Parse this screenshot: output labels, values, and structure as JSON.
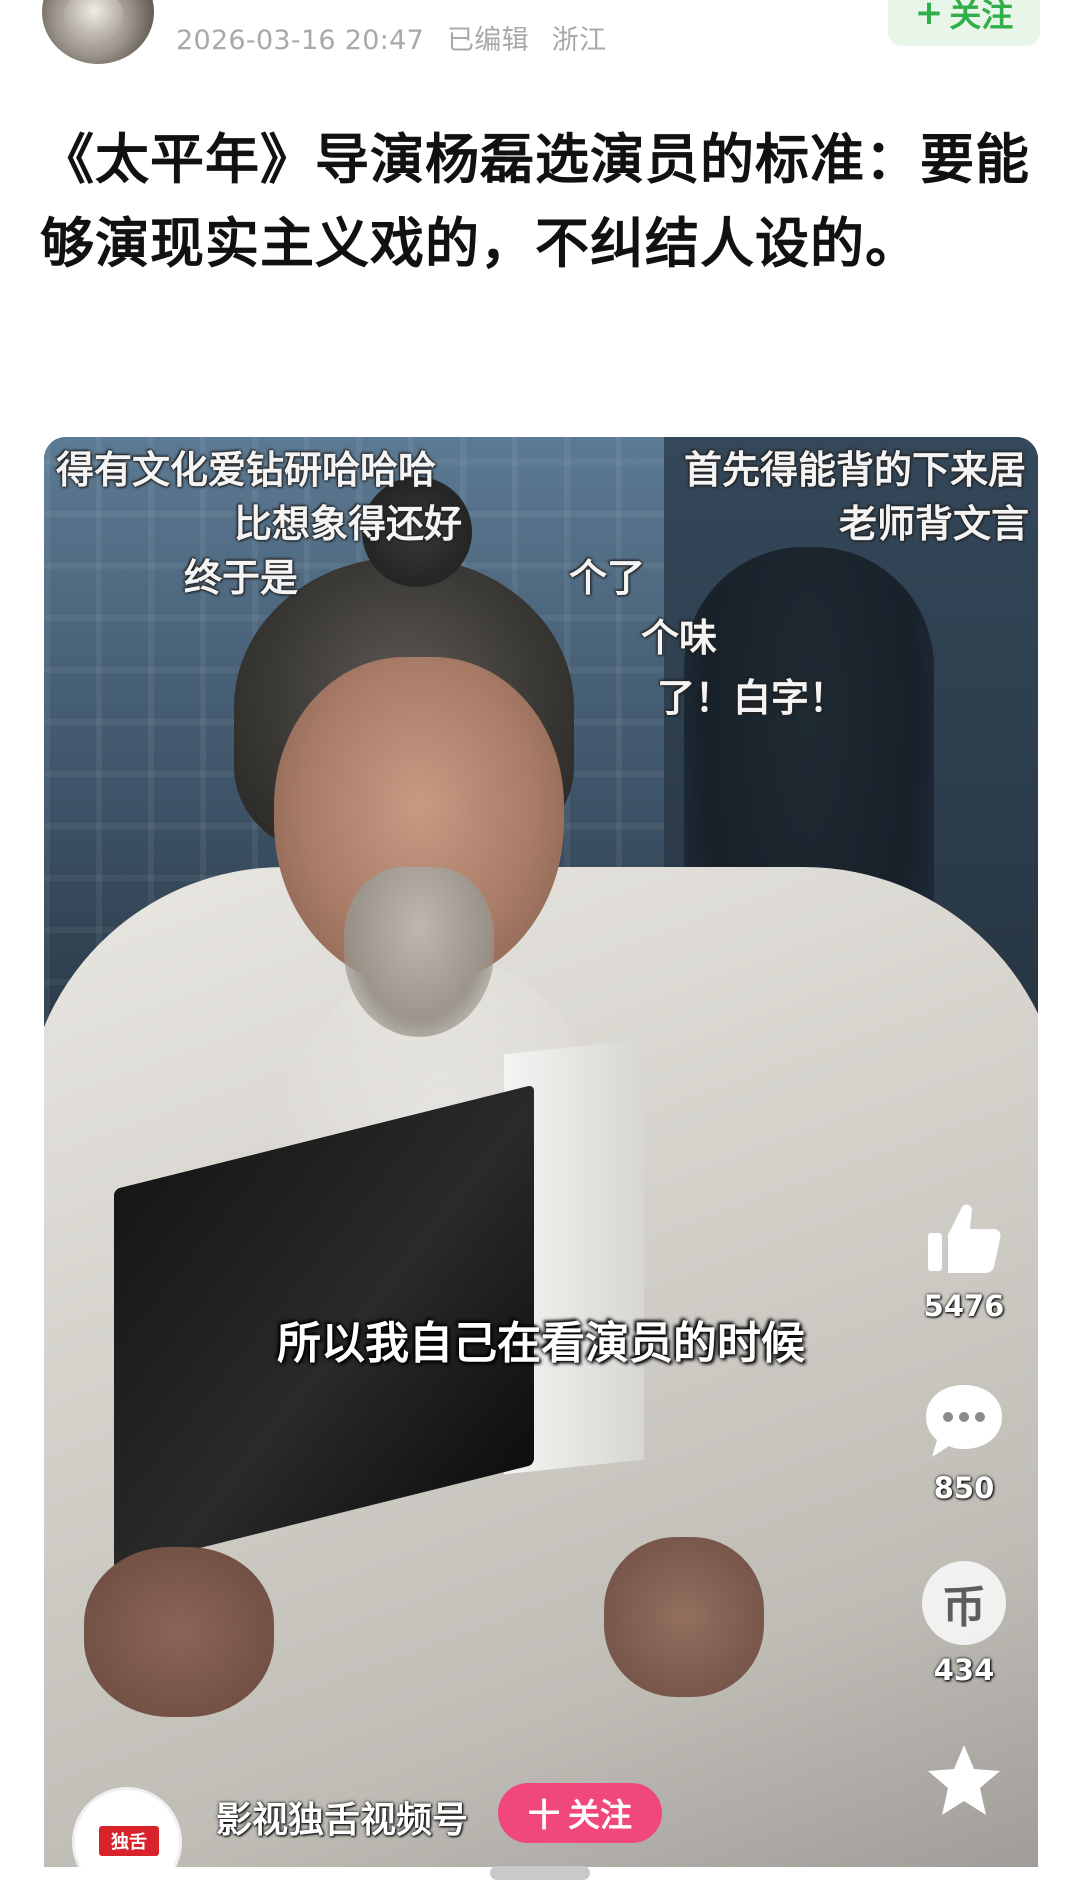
{
  "header": {
    "date": "2026-03-16 20:47",
    "edited": "已编辑",
    "location": "浙江",
    "follow_label": "关注",
    "follow_plus": "+"
  },
  "post": {
    "title": "《太平年》导演杨磊选演员的标准：要能够演现实主义戏的，不纠结人设的。"
  },
  "video": {
    "danmaku": [
      "得有文化爱钻研哈哈哈",
      "首先得能背的下来居",
      "比想象得还好",
      "老师背文言",
      "终于是",
      "个了",
      "个味",
      "了！白字！"
    ],
    "subtitle": "所以我自己在看演员的时候",
    "actions": {
      "likes": "5476",
      "comments": "850",
      "coins": "434",
      "coin_glyph": "币"
    },
    "author": {
      "name": "影视独舌视频号",
      "badge": "独舌",
      "follow_label": "关注",
      "follow_plus": "十"
    }
  },
  "colors": {
    "follow_green": "#2fae4a",
    "follow_green_bg": "#e8f6ea",
    "follow_pink": "#f0487a",
    "meta_gray": "#a9a9a9"
  },
  "icons": [
    "thumbs-up-icon",
    "comment-bubble-icon",
    "coin-icon",
    "star-icon"
  ]
}
